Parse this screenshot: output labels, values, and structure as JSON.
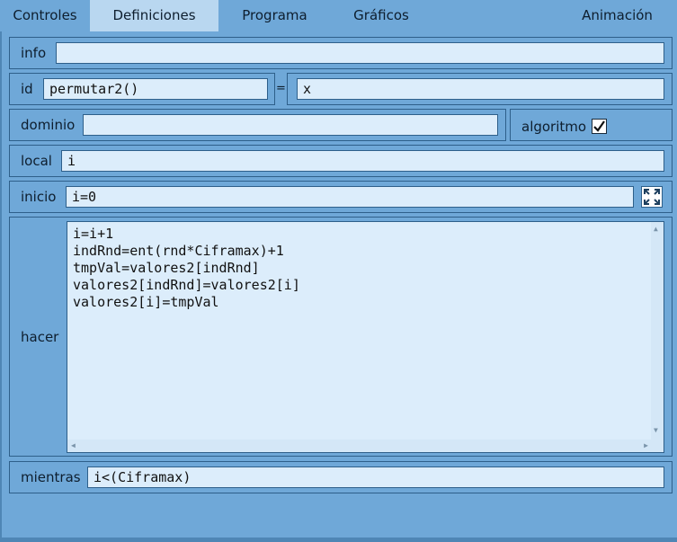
{
  "tabs": [
    {
      "label": "Controles"
    },
    {
      "label": "Definiciones"
    },
    {
      "label": "Programa"
    },
    {
      "label": "Gráficos"
    },
    {
      "label": "Animación"
    }
  ],
  "active_tab": "Definiciones",
  "form": {
    "info": {
      "label": "info",
      "value": ""
    },
    "id": {
      "label": "id",
      "value": "permutar2()",
      "equals": "=",
      "rhs": "x"
    },
    "dominio": {
      "label": "dominio",
      "value": ""
    },
    "algoritmo": {
      "label": "algoritmo",
      "checked": true
    },
    "local": {
      "label": "local",
      "value": "i"
    },
    "inicio": {
      "label": "inicio",
      "value": "i=0"
    },
    "hacer": {
      "label": "hacer",
      "lines": [
        "i=i+1",
        "indRnd=ent(rnd*Ciframax)+1",
        "tmpVal=valores2[indRnd]",
        "valores2[indRnd]=valores2[i]",
        "valores2[i]=tmpVal"
      ]
    },
    "mientras": {
      "label": "mientras",
      "value": "i<(Ciframax)"
    }
  },
  "colors": {
    "background": "#6fa8d8",
    "active_tab": "#b9d7f0",
    "field": "#dcedfb",
    "border": "#2e5f8a"
  },
  "icons": [
    "check-icon",
    "expand-icon",
    "scroll-up-icon",
    "scroll-down-icon",
    "scroll-left-icon",
    "scroll-right-icon"
  ]
}
